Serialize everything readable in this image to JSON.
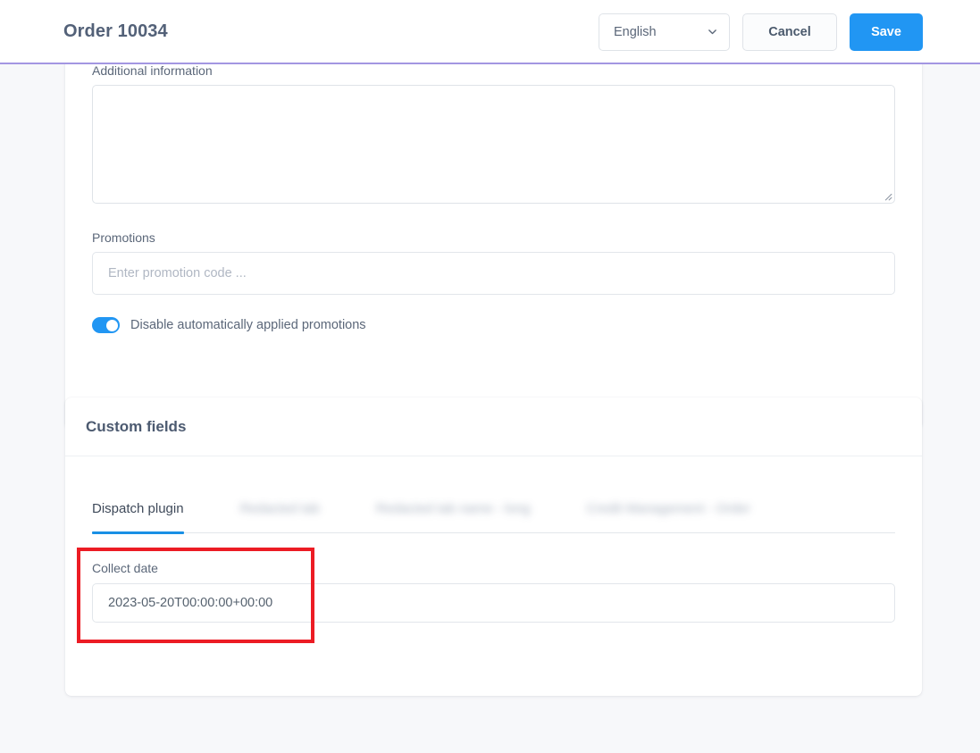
{
  "topbar": {
    "title": "Order 10034",
    "language_selected": "English",
    "language_icon": "chevron-down-icon",
    "cancel_label": "Cancel",
    "save_label": "Save",
    "save_color": "#2196f3",
    "rule_color": "#a396e2"
  },
  "details_card": {
    "additional_information": {
      "label": "Additional information",
      "value": ""
    },
    "promotions": {
      "label": "Promotions",
      "placeholder": "Enter promotion code ...",
      "value": ""
    },
    "disable_promotions_toggle": {
      "label": "Disable automatically applied promotions",
      "state": "on",
      "color": "#2196f3"
    }
  },
  "custom_fields_card": {
    "title": "Custom fields",
    "tabs": [
      {
        "label": "Dispatch plugin",
        "active": true,
        "redacted": false
      },
      {
        "label": "Redacted tab",
        "active": false,
        "redacted": true
      },
      {
        "label": "Redacted tab name - long",
        "active": false,
        "redacted": true
      },
      {
        "label": "Credit Management - Order",
        "active": false,
        "redacted": true
      }
    ],
    "active_tab_indicator_color": "#1990e5",
    "fields": [
      {
        "label": "Collect date",
        "value": "2023-05-20T00:00:00+00:00"
      }
    ]
  },
  "annotation": {
    "type": "highlight-rectangle",
    "color": "#ec1c24",
    "target": "Collect date field"
  }
}
